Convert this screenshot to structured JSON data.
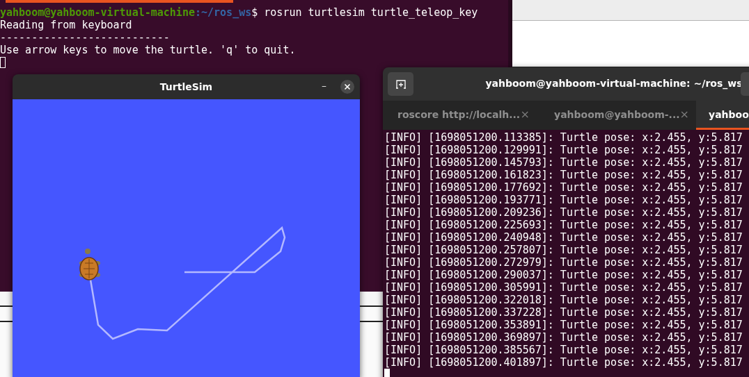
{
  "back_terminal": {
    "prompt": {
      "user_host": "yahboom@yahboom-virtual-machine",
      "path": ":~/ros_ws",
      "command": "$ rosrun turtlesim turtle_teleop_key"
    },
    "output": [
      "Reading from keyboard",
      "---------------------------",
      "Use arrow keys to move the turtle. 'q' to quit."
    ]
  },
  "turtlesim": {
    "title": "TurtleSim",
    "minimize": "–"
  },
  "terminal": {
    "title": "yahboom@yahboom-virtual-machine: ~/ros_ws",
    "tabs": [
      {
        "label": "roscore http://localh...",
        "selected": false,
        "close": "×"
      },
      {
        "label": "yahboom@yahboom-...",
        "selected": false,
        "close": "×"
      },
      {
        "label": "yahboo",
        "selected": true
      }
    ],
    "lines": [
      "[INFO] [1698051200.113385]: Turtle pose: x:2.455, y:5.817",
      "[INFO] [1698051200.129991]: Turtle pose: x:2.455, y:5.817",
      "[INFO] [1698051200.145793]: Turtle pose: x:2.455, y:5.817",
      "[INFO] [1698051200.161823]: Turtle pose: x:2.455, y:5.817",
      "[INFO] [1698051200.177692]: Turtle pose: x:2.455, y:5.817",
      "[INFO] [1698051200.193771]: Turtle pose: x:2.455, y:5.817",
      "[INFO] [1698051200.209236]: Turtle pose: x:2.455, y:5.817",
      "[INFO] [1698051200.225693]: Turtle pose: x:2.455, y:5.817",
      "[INFO] [1698051200.240948]: Turtle pose: x:2.455, y:5.817",
      "[INFO] [1698051200.257807]: Turtle pose: x:2.455, y:5.817",
      "[INFO] [1698051200.272979]: Turtle pose: x:2.455, y:5.817",
      "[INFO] [1698051200.290037]: Turtle pose: x:2.455, y:5.817",
      "[INFO] [1698051200.305991]: Turtle pose: x:2.455, y:5.817",
      "[INFO] [1698051200.322018]: Turtle pose: x:2.455, y:5.817",
      "[INFO] [1698051200.337228]: Turtle pose: x:2.455, y:5.817",
      "[INFO] [1698051200.353891]: Turtle pose: x:2.455, y:5.817",
      "[INFO] [1698051200.369897]: Turtle pose: x:2.455, y:5.817",
      "[INFO] [1698051200.385567]: Turtle pose: x:2.455, y:5.817",
      "[INFO] [1698051200.401897]: Turtle pose: x:2.455, y:5.817"
    ]
  }
}
